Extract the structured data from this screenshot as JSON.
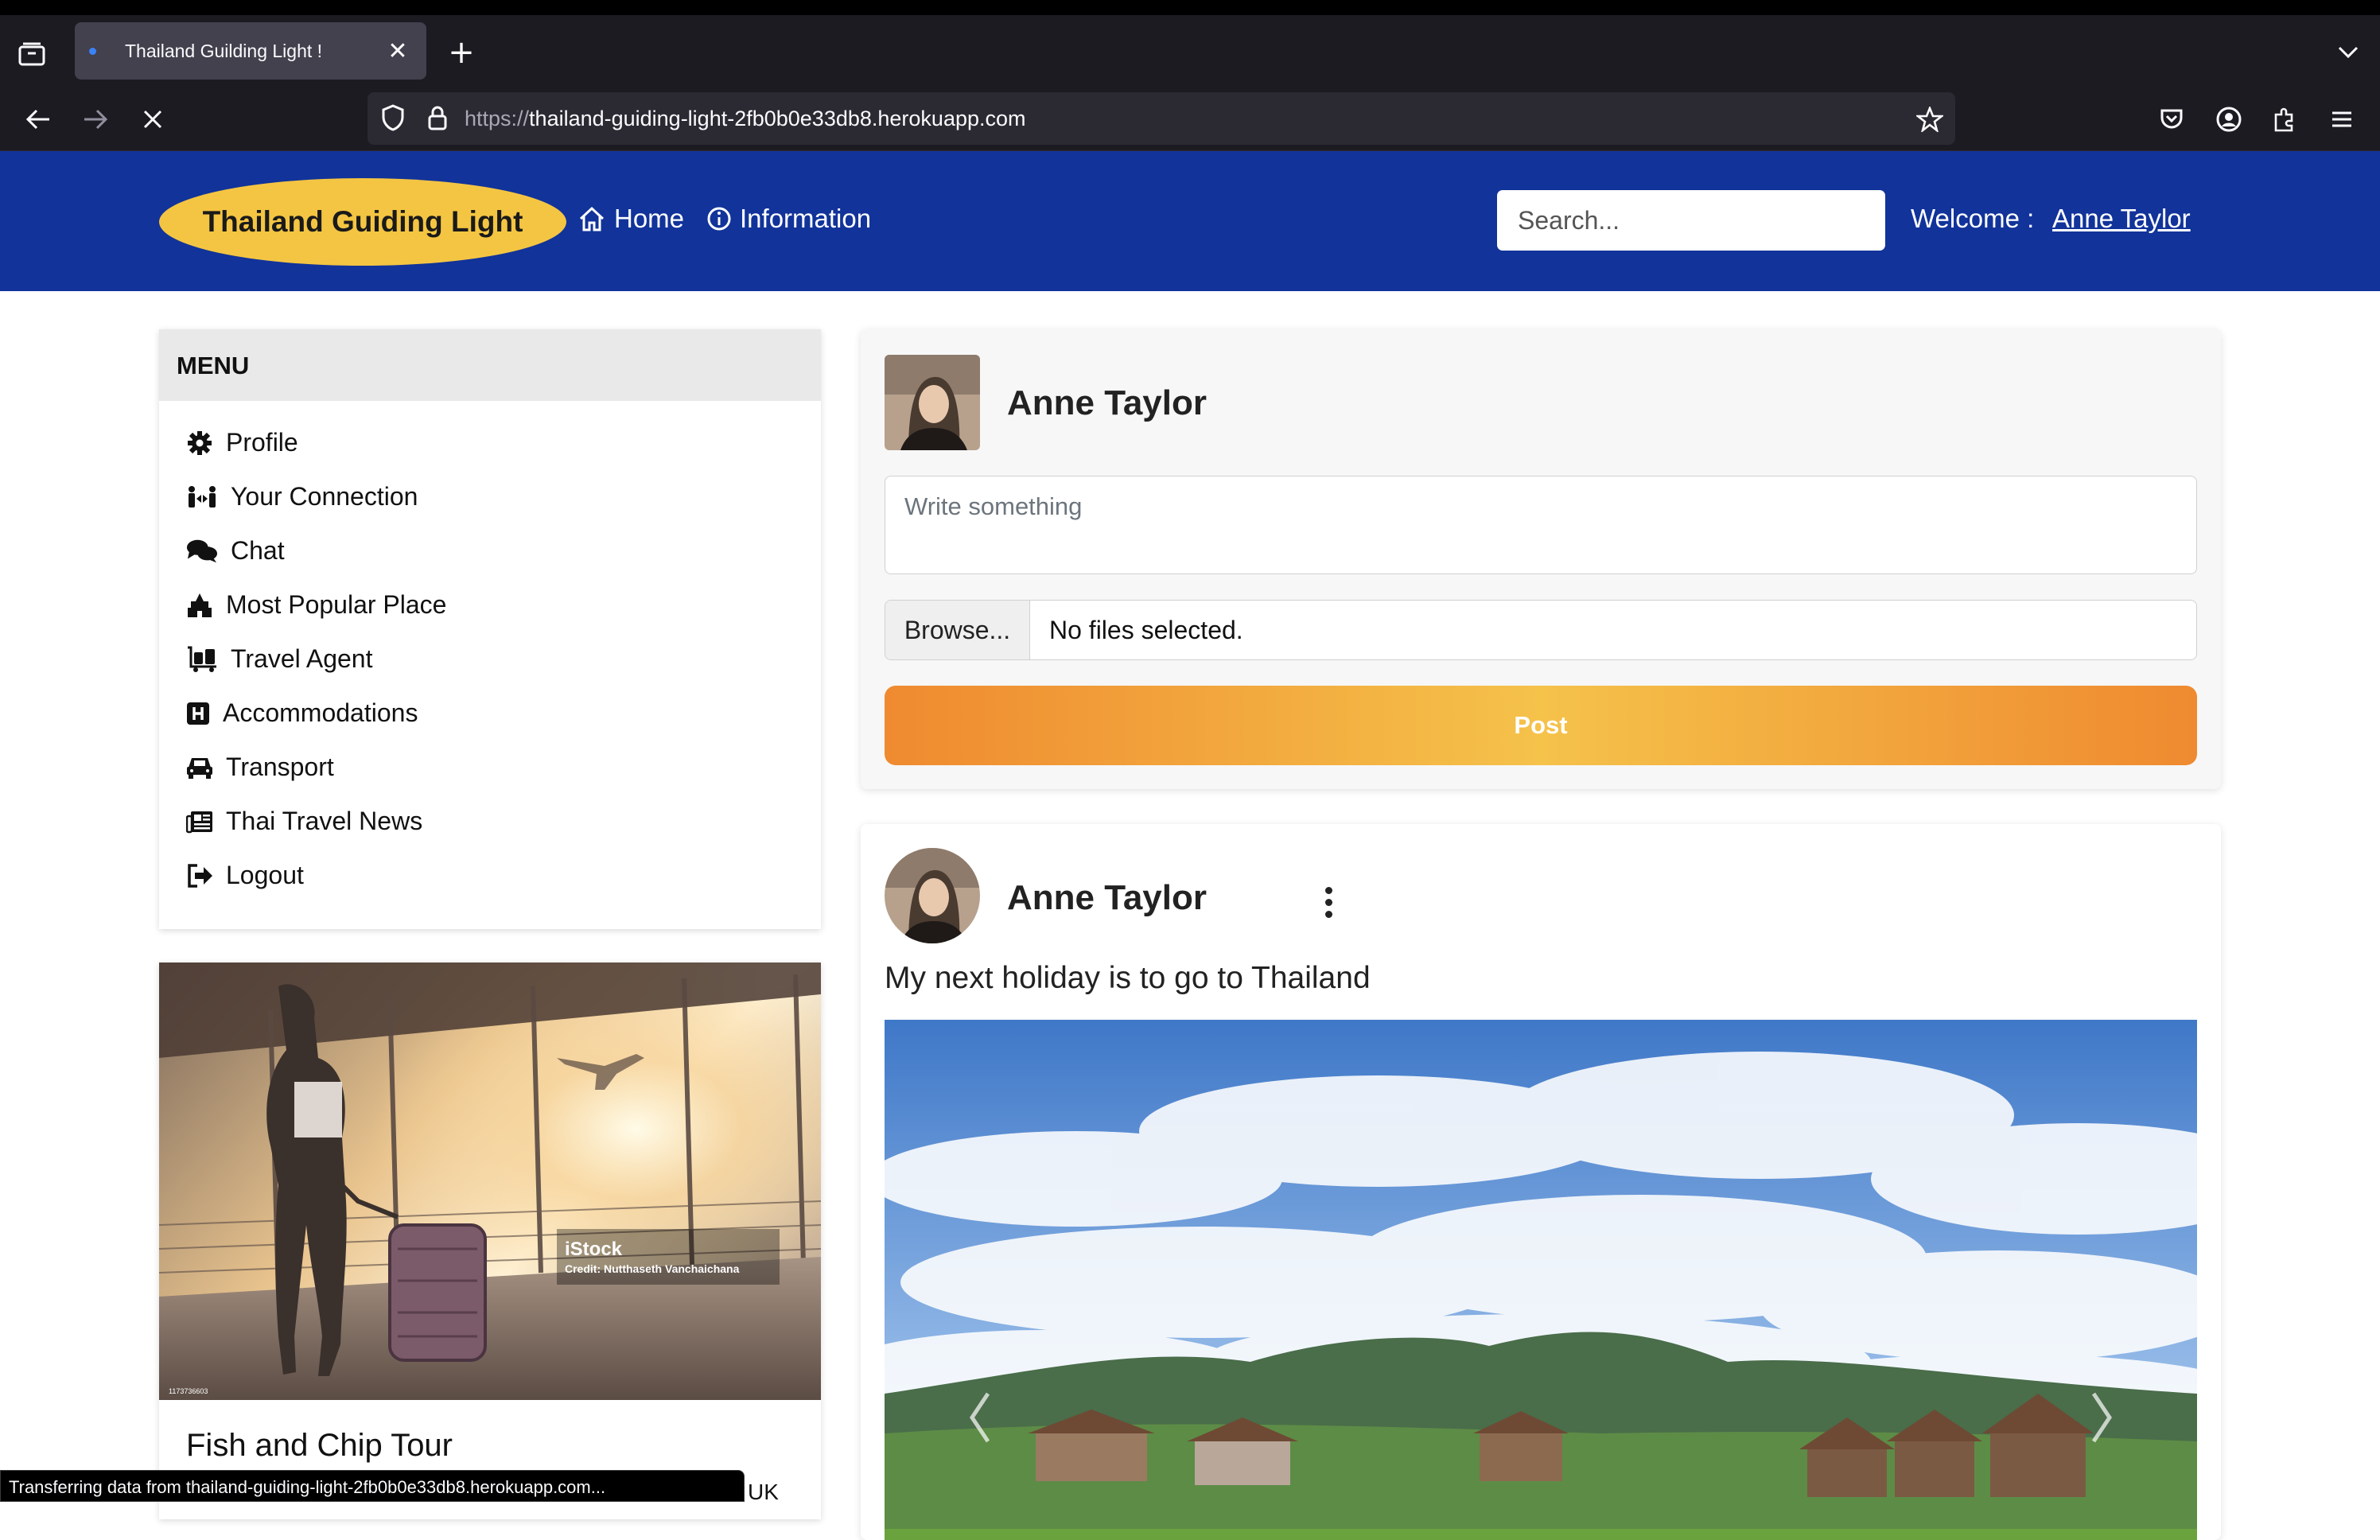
{
  "browser": {
    "tab_title": "Thailand Guilding Light !",
    "url_prefix": "https://",
    "url_host": "thailand-guiding-light-2fb0b0e33db8.herokuapp.com",
    "status_text": "Transferring data from thailand-guiding-light-2fb0b0e33db8.herokuapp.com..."
  },
  "header": {
    "logo": "Thailand Guiding Light",
    "nav_home": "Home",
    "nav_information": "Information",
    "search_placeholder": "Search...",
    "welcome_label": "Welcome :",
    "username": "Anne Taylor"
  },
  "menu": {
    "title": "MENU",
    "items": [
      {
        "label": "Profile",
        "icon": "gear-icon"
      },
      {
        "label": "Your Connection",
        "icon": "people-arrows-icon"
      },
      {
        "label": "Chat",
        "icon": "comments-icon"
      },
      {
        "label": "Most Popular Place",
        "icon": "landmark-icon"
      },
      {
        "label": "Travel Agent",
        "icon": "luggage-cart-icon"
      },
      {
        "label": "Accommodations",
        "icon": "hotel-h-icon"
      },
      {
        "label": "Transport",
        "icon": "car-icon"
      },
      {
        "label": "Thai Travel News",
        "icon": "newspaper-icon"
      },
      {
        "label": "Logout",
        "icon": "sign-out-icon"
      }
    ]
  },
  "promo": {
    "image_watermark": "iStock",
    "image_credit": "Credit: Nutthaseth Vanchaichana",
    "image_id": "1173736603",
    "title": "Fish and Chip Tour",
    "peek_text": "UK"
  },
  "composer": {
    "user": "Anne Taylor",
    "textarea_placeholder": "Write something",
    "browse_label": "Browse...",
    "file_status": "No files selected.",
    "post_label": "Post"
  },
  "post": {
    "user": "Anne Taylor",
    "text": "My next holiday is to go to Thailand"
  },
  "colors": {
    "header_bg": "#11339a",
    "logo_bg": "#f4c542",
    "post_btn_gradient": [
      "#ef8a30",
      "#f5c24a"
    ]
  }
}
